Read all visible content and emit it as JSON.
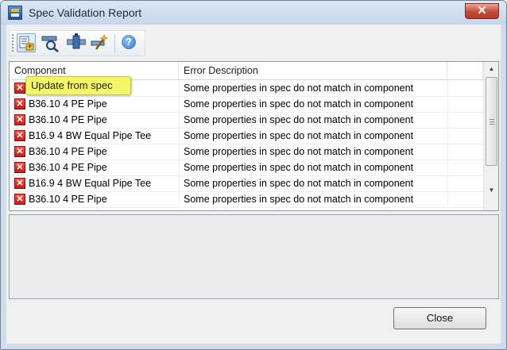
{
  "window": {
    "title": "Spec Validation Report",
    "close_glyph": "✕"
  },
  "toolbar": {
    "buttons": [
      {
        "name": "update-from-spec-icon",
        "active": true
      },
      {
        "name": "zoom-to-component-icon",
        "active": false
      },
      {
        "name": "pipe-connect-icon",
        "active": false
      },
      {
        "name": "wand-fix-icon",
        "active": false
      },
      {
        "name": "help-icon",
        "active": false,
        "glyph": "?"
      }
    ]
  },
  "grid": {
    "columns": [
      "Component",
      "Error Description",
      ""
    ],
    "rows": [
      {
        "component": "",
        "error": "Some properties in spec do not match in component"
      },
      {
        "component": "B36.10 4 PE Pipe",
        "error": "Some properties in spec do not match in component"
      },
      {
        "component": "B36.10 4 PE Pipe",
        "error": "Some properties in spec do not match in component"
      },
      {
        "component": "B16.9 4 BW Equal Pipe Tee",
        "error": "Some properties in spec do not match in component"
      },
      {
        "component": "B36.10 4 PE Pipe",
        "error": "Some properties in spec do not match in component"
      },
      {
        "component": "B36.10 4 PE Pipe",
        "error": "Some properties in spec do not match in component"
      },
      {
        "component": "B16.9 4 BW Equal Pipe Tee",
        "error": "Some properties in spec do not match in component"
      },
      {
        "component": "B36.10 4 PE Pipe",
        "error": "Some properties in spec do not match in component"
      }
    ],
    "error_glyph": "✕",
    "scroll_up_glyph": "▲",
    "scroll_down_glyph": "▼"
  },
  "tooltip": {
    "text": "Update from spec"
  },
  "footer": {
    "close_label": "Close"
  },
  "colors": {
    "error_icon": "#c41e14",
    "tooltip_bg": "#f5f569",
    "titlebar": "#cfdded"
  }
}
